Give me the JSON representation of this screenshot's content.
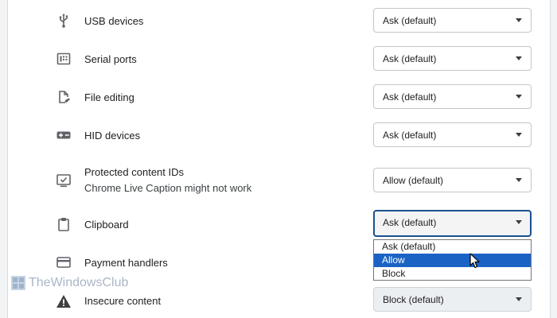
{
  "permissions": [
    {
      "name": "usb",
      "icon": "usb-icon",
      "label": "USB devices",
      "value": "Ask (default)"
    },
    {
      "name": "serial",
      "icon": "serial-port-icon",
      "label": "Serial ports",
      "value": "Ask (default)"
    },
    {
      "name": "file-editing",
      "icon": "file-edit-icon",
      "label": "File editing",
      "value": "Ask (default)"
    },
    {
      "name": "hid",
      "icon": "gamepad-icon",
      "label": "HID devices",
      "value": "Ask (default)"
    },
    {
      "name": "protected-content",
      "icon": "protected-content-icon",
      "label": "Protected content IDs",
      "sublabel": "Chrome Live Caption might not work",
      "value": "Allow (default)"
    },
    {
      "name": "clipboard",
      "icon": "clipboard-icon",
      "label": "Clipboard",
      "value": "Ask (default)"
    },
    {
      "name": "payment-handlers",
      "icon": "credit-card-icon",
      "label": "Payment handlers"
    },
    {
      "name": "insecure-content",
      "icon": "warning-icon",
      "label": "Insecure content",
      "value": "Block (default)"
    }
  ],
  "clipboard_dropdown": {
    "options": [
      "Ask (default)",
      "Allow",
      "Block"
    ],
    "highlighted": "Allow"
  },
  "watermark": {
    "text": "TheWindowsClub"
  },
  "colors": {
    "focus_border": "#1a4f8f",
    "highlight": "#1a63c5"
  }
}
